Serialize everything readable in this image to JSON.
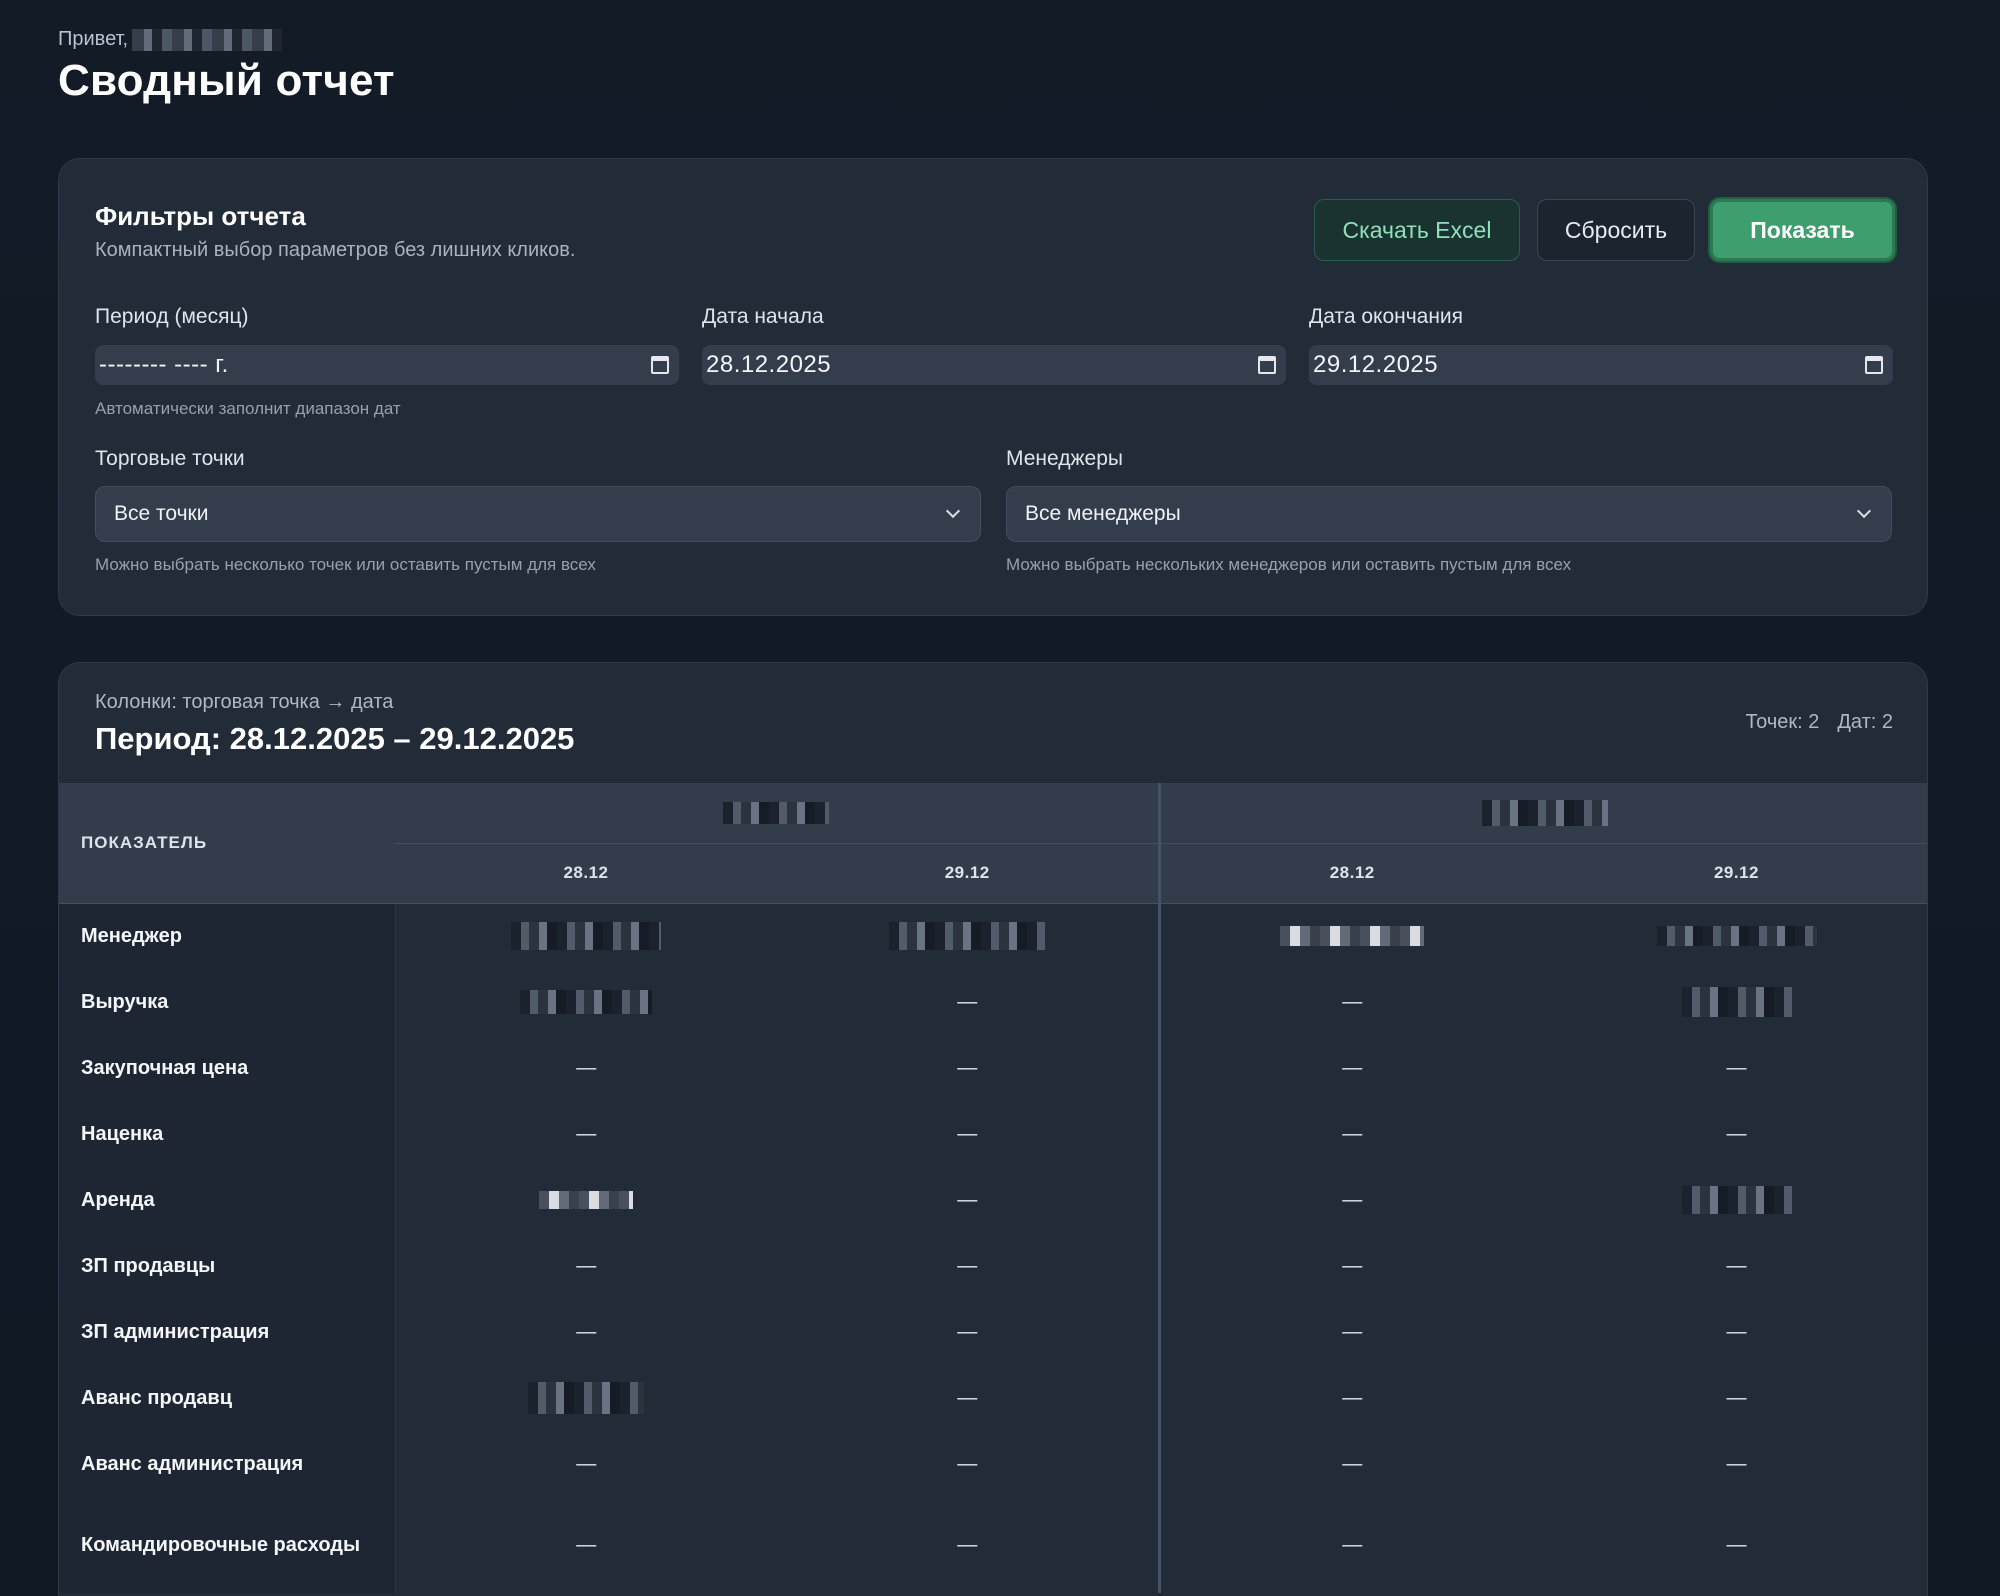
{
  "header": {
    "greeting": "Привет,",
    "title": "Сводный отчет"
  },
  "filters": {
    "title": "Фильтры отчета",
    "subtitle": "Компактный выбор параметров без лишних кликов.",
    "buttons": {
      "excel": "Скачать Excel",
      "reset": "Сбросить",
      "show": "Показать"
    },
    "period": {
      "label": "Период (месяц)",
      "value": "-------- ---- г.",
      "hint": "Автоматически заполнит диапазон дат"
    },
    "start_date": {
      "label": "Дата начала",
      "value": "28.12.2025"
    },
    "end_date": {
      "label": "Дата окончания",
      "value": "29.12.2025"
    },
    "stores": {
      "label": "Торговые точки",
      "value": "Все точки",
      "hint": "Можно выбрать несколько точек или оставить пустым для всех"
    },
    "managers": {
      "label": "Менеджеры",
      "value": "Все менеджеры",
      "hint": "Можно выбрать нескольких менеджеров или оставить пустым для всех"
    }
  },
  "report": {
    "kicker": "Колонки: торговая точка → дата",
    "title": "Период: 28.12.2025 – 29.12.2025",
    "counts": {
      "stores": "Точек: 2",
      "dates": "Дат: 2"
    },
    "table": {
      "metric_header": "ПОКАЗАТЕЛЬ",
      "dates": [
        "28.12",
        "29.12",
        "28.12",
        "29.12"
      ],
      "rows": [
        {
          "metric": "Менеджер",
          "values": [
            "",
            "",
            "",
            ""
          ]
        },
        {
          "metric": "Выручка",
          "values": [
            "",
            "—",
            "—",
            ""
          ]
        },
        {
          "metric": "Закупочная цена",
          "values": [
            "—",
            "—",
            "—",
            "—"
          ]
        },
        {
          "metric": "Наценка",
          "values": [
            "—",
            "—",
            "—",
            "—"
          ]
        },
        {
          "metric": "Аренда",
          "values": [
            "",
            "—",
            "—",
            ""
          ]
        },
        {
          "metric": "ЗП продавцы",
          "values": [
            "—",
            "—",
            "—",
            "—"
          ]
        },
        {
          "metric": "ЗП администрация",
          "values": [
            "—",
            "—",
            "—",
            "—"
          ]
        },
        {
          "metric": "Аванс продавц",
          "values": [
            "",
            "—",
            "—",
            "—"
          ]
        },
        {
          "metric": "Аванс администрация",
          "values": [
            "—",
            "—",
            "—",
            "—"
          ]
        },
        {
          "metric": "Командировочные расходы",
          "values": [
            "—",
            "—",
            "—",
            "—"
          ]
        }
      ]
    }
  }
}
